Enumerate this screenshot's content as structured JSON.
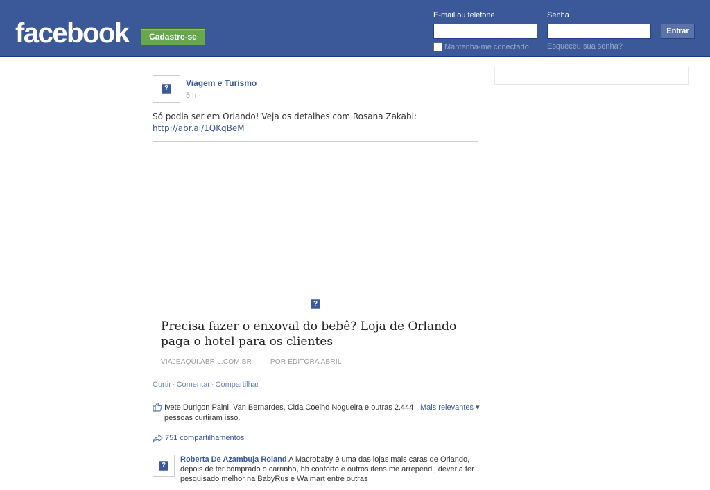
{
  "header": {
    "logo": "facebook",
    "signup_label": "Cadastre-se",
    "email_label": "E-mail ou telefone",
    "password_label": "Senha",
    "login_label": "Entrar",
    "remember_label": "Mantenha-me conectado",
    "forgot_label": "Esqueceu sua senha?"
  },
  "post": {
    "page_name": "Viagem e Turismo",
    "time": "5 h",
    "time_dot": "·",
    "text": "Só podia ser em Orlando! Veja os detalhes com Rosana Zakabi:",
    "link": "http://abr.ai/1QKqBeM",
    "article": {
      "title": "Precisa fazer o enxoval do bebê? Loja de Orlando paga o hotel para os clientes",
      "domain": "VIAJEAQUI.ABRIL.COM.BR",
      "separator": "|",
      "author": "POR EDITORA ABRIL"
    },
    "actions": {
      "like": "Curtir",
      "comment": "Comentar",
      "share": "Compartilhar",
      "separator": "·"
    },
    "likes_text": "Ivete Durigon Paini, Van Bernardes, Cida Coelho Nogueira e outras 2.444 pessoas curtiram isso.",
    "sort_label": "Mais relevantes ▾",
    "shares_text": "751 compartilhamentos",
    "comment": {
      "author": "Roberta De Azambuja Roland",
      "text": "A Macrobaby é uma das lojas mais caras de Orlando, depois de ter comprado o carrinho, bb conforto e outros itens me arrependi, deveria ter pesquisado melhor na BabyRus e Walmart entre outras"
    }
  },
  "icons": {
    "missing_image": "?",
    "like": "thumbs-up-icon",
    "share": "share-arrow-icon"
  },
  "colors": {
    "brand": "#3b5998",
    "signup_green": "#69a74e",
    "link": "#3b5998"
  }
}
